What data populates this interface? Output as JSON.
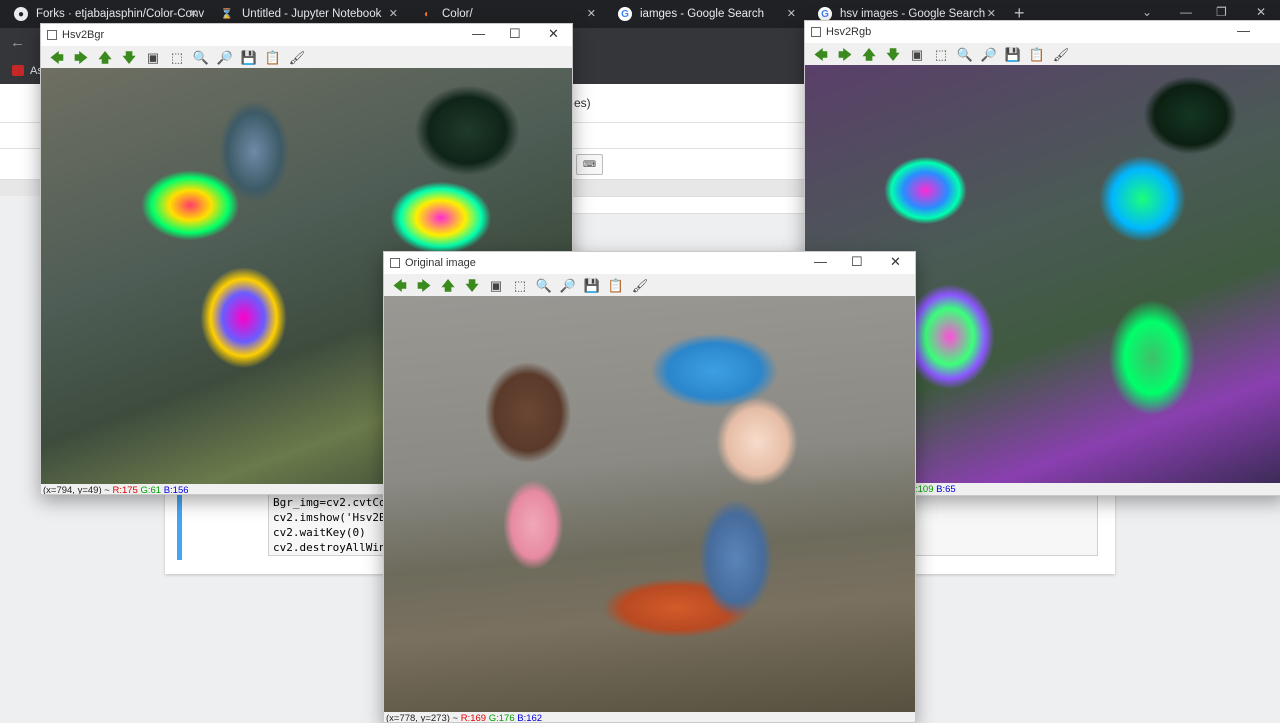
{
  "browser": {
    "tabs": [
      {
        "title": "Forks · etjabajasphin/Color-Conv",
        "icon": "github-icon",
        "icon_color": "#e8eaed"
      },
      {
        "title": "Untitled - Jupyter Notebook",
        "icon": "hourglass-icon",
        "icon_color": "#f37626"
      },
      {
        "title": "Color/",
        "icon": "jupyter-icon",
        "icon_color": "#f37626"
      },
      {
        "title": "iamges - Google Search",
        "icon": "google-icon",
        "icon_color": "#ffffff"
      },
      {
        "title": "hsv images - Google Search",
        "icon": "google-icon",
        "icon_color": "#ffffff"
      }
    ],
    "new_tab_glyph": "+",
    "window_controls": {
      "chevron": "⌄",
      "minimize": "—",
      "maximize": "❐",
      "close": "✕"
    },
    "back_glyph": "←",
    "bookmark_label": "As"
  },
  "notebook": {
    "header_fragment": "es)",
    "keyboard_button": "⌨",
    "code_lines": [
      "Bgr_img=cv2.cvtCo",
      "cv2.imshow('Hsv2B",
      "cv2.waitKey(0)",
      "cv2.destroyAllWin"
    ]
  },
  "windows": {
    "hsv2bgr": {
      "title": "Hsv2Bgr",
      "status": {
        "coord": "(x=794, y=49) ~ ",
        "r": "R:175",
        "g": "G:61",
        "b": "B:156"
      }
    },
    "hsv2rgb": {
      "title": "Hsv2Rgb",
      "status": {
        "g": ":109",
        "b": "B:65"
      }
    },
    "original": {
      "title": "Original image",
      "status": {
        "coord": "(x=778, y=273) ~ ",
        "r": "R:169",
        "g": "G:176",
        "b": "B:162"
      }
    },
    "controls": {
      "minimize": "—",
      "maximize": "☐",
      "close": "✕"
    },
    "toolbar": [
      {
        "name": "pan-left-icon",
        "glyph": "🡄"
      },
      {
        "name": "pan-right-icon",
        "glyph": "🡆"
      },
      {
        "name": "pan-up-icon",
        "glyph": "🡅"
      },
      {
        "name": "pan-down-icon",
        "glyph": "🡇"
      },
      {
        "name": "zoom-fit-icon",
        "glyph": "▣"
      },
      {
        "name": "zoom-original-icon",
        "glyph": "⬚"
      },
      {
        "name": "zoom-in-icon",
        "glyph": "🔍"
      },
      {
        "name": "zoom-out-icon",
        "glyph": "🔎"
      },
      {
        "name": "save-icon",
        "glyph": "💾"
      },
      {
        "name": "copy-icon",
        "glyph": "📋"
      },
      {
        "name": "properties-icon",
        "glyph": "🖌"
      }
    ]
  }
}
